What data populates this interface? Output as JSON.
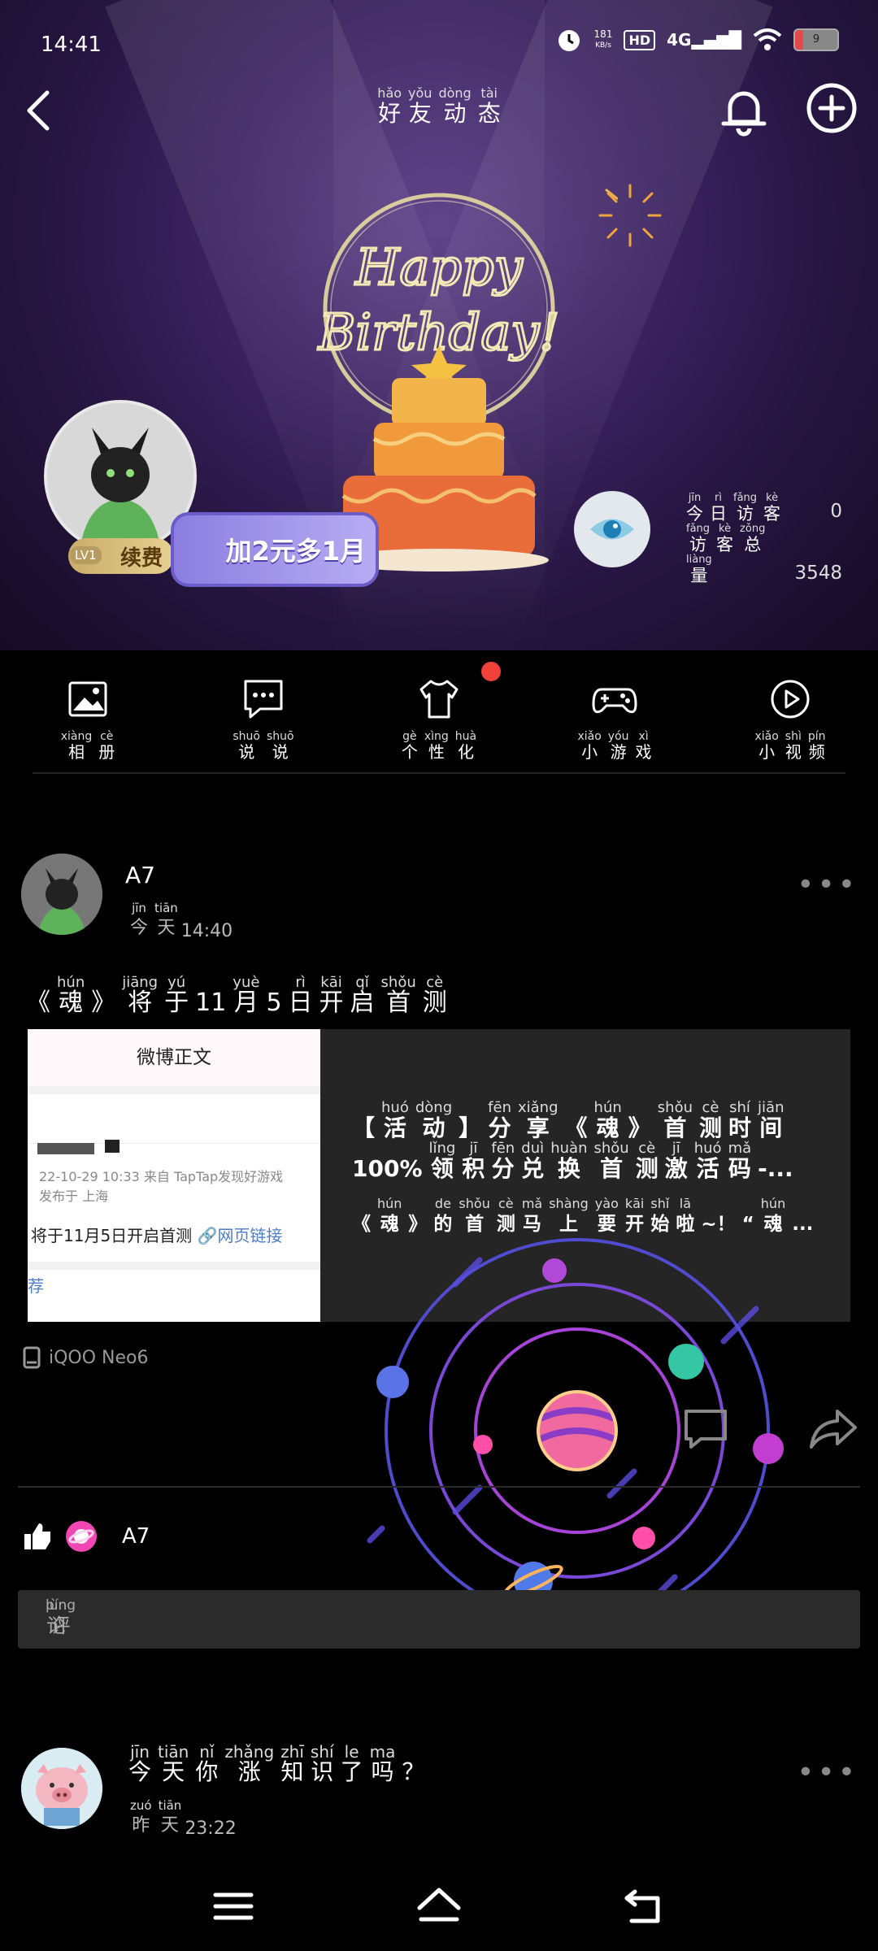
{
  "status_bar": {
    "time": "14:41",
    "net_speed": "181",
    "net_unit": "KB/s",
    "hd": "HD",
    "signal": "4G",
    "battery": "9"
  },
  "header": {
    "title": [
      {
        "py": "hǎo",
        "hz": "好"
      },
      {
        "py": "yǒu",
        "hz": "友"
      },
      {
        "py": "dòng",
        "hz": "动"
      },
      {
        "py": "tài",
        "hz": "态"
      }
    ]
  },
  "banner": {
    "renew_label": "续费",
    "level": "LV1",
    "promo": "加2元多1月",
    "visitors_today_label": [
      {
        "py": "jīn",
        "hz": "今"
      },
      {
        "py": "rì",
        "hz": "日"
      },
      {
        "py": "fǎng",
        "hz": "访"
      },
      {
        "py": "kè",
        "hz": "客"
      }
    ],
    "visitors_today": "0",
    "visitors_total_label": [
      {
        "py": "fǎng",
        "hz": "访"
      },
      {
        "py": "kè",
        "hz": "客"
      },
      {
        "py": "zǒng",
        "hz": "总"
      },
      {
        "py": "liàng",
        "hz": "量"
      }
    ],
    "visitors_total": "3548"
  },
  "menu": [
    {
      "icon": "album-icon",
      "label": [
        {
          "py": "xiàng",
          "hz": "相"
        },
        {
          "py": "cè",
          "hz": "册"
        }
      ]
    },
    {
      "icon": "talk-icon",
      "label": [
        {
          "py": "shuō",
          "hz": "说"
        },
        {
          "py": "shuō",
          "hz": "说"
        }
      ]
    },
    {
      "icon": "shirt-icon",
      "label": [
        {
          "py": "gè",
          "hz": "个"
        },
        {
          "py": "xìng",
          "hz": "性"
        },
        {
          "py": "huà",
          "hz": "化"
        }
      ]
    },
    {
      "icon": "gamepad-icon",
      "label": [
        {
          "py": "xiǎo",
          "hz": "小"
        },
        {
          "py": "yóu",
          "hz": "游"
        },
        {
          "py": "xì",
          "hz": "戏"
        }
      ]
    },
    {
      "icon": "video-icon",
      "label": [
        {
          "py": "xiǎo",
          "hz": "小"
        },
        {
          "py": "shì",
          "hz": "视"
        },
        {
          "py": "pín",
          "hz": "频"
        }
      ]
    }
  ],
  "post1": {
    "username": "A7",
    "time_word": [
      {
        "py": "jīn",
        "hz": "今"
      },
      {
        "py": "tiān",
        "hz": "天"
      }
    ],
    "time_clock": "14:40",
    "text": [
      {
        "py": "",
        "hz": "《"
      },
      {
        "py": "hún",
        "hz": "魂"
      },
      {
        "py": "",
        "hz": "》"
      },
      {
        "py": "jiāng",
        "hz": "将"
      },
      {
        "py": "yú",
        "hz": "于"
      },
      {
        "py": "",
        "hz": "11"
      },
      {
        "py": "yuè",
        "hz": "月"
      },
      {
        "py": "",
        "hz": "5"
      },
      {
        "py": "rì",
        "hz": "日"
      },
      {
        "py": "kāi",
        "hz": "开"
      },
      {
        "py": "qǐ",
        "hz": "启"
      },
      {
        "py": "shǒu",
        "hz": "首"
      },
      {
        "py": "cè",
        "hz": "测"
      }
    ],
    "card_left": {
      "header": "微博正文",
      "meta1": "22-10-29 10:33  来自 TapTap发现好游戏",
      "meta2": "发布于 上海",
      "body": "将于11月5日开启首测",
      "link": "🔗网页链接",
      "footer": "荐"
    },
    "card_title_1": [
      {
        "py": "",
        "hz": "【"
      },
      {
        "py": "huó",
        "hz": "活"
      },
      {
        "py": "dòng",
        "hz": "动"
      },
      {
        "py": "",
        "hz": "】"
      },
      {
        "py": "fēn",
        "hz": "分"
      },
      {
        "py": "xiǎng",
        "hz": "享"
      },
      {
        "py": "",
        "hz": "《"
      },
      {
        "py": "hún",
        "hz": "魂"
      },
      {
        "py": "",
        "hz": "》"
      },
      {
        "py": "shǒu",
        "hz": "首"
      },
      {
        "py": "cè",
        "hz": "测"
      },
      {
        "py": "shí",
        "hz": "时"
      },
      {
        "py": "jiān",
        "hz": "间"
      }
    ],
    "card_title_2": [
      {
        "py": "",
        "hz": "100%"
      },
      {
        "py": "lǐng",
        "hz": "领"
      },
      {
        "py": "jī",
        "hz": "积"
      },
      {
        "py": "fēn",
        "hz": "分"
      },
      {
        "py": "duì",
        "hz": "兑"
      },
      {
        "py": "huàn",
        "hz": "换"
      },
      {
        "py": "shǒu",
        "hz": "首"
      },
      {
        "py": "cè",
        "hz": "测"
      },
      {
        "py": "jī",
        "hz": "激"
      },
      {
        "py": "huó",
        "hz": "活"
      },
      {
        "py": "mǎ",
        "hz": "码"
      },
      {
        "py": "",
        "hz": "-..."
      }
    ],
    "card_sub": [
      {
        "py": "",
        "hz": "《"
      },
      {
        "py": "hún",
        "hz": "魂"
      },
      {
        "py": "",
        "hz": "》"
      },
      {
        "py": "de",
        "hz": "的"
      },
      {
        "py": "shǒu",
        "hz": "首"
      },
      {
        "py": "cè",
        "hz": "测"
      },
      {
        "py": "mǎ",
        "hz": "马"
      },
      {
        "py": "shàng",
        "hz": "上"
      },
      {
        "py": "yào",
        "hz": "要"
      },
      {
        "py": "kāi",
        "hz": "开"
      },
      {
        "py": "shǐ",
        "hz": "始"
      },
      {
        "py": "lā",
        "hz": "啦"
      },
      {
        "py": "",
        "hz": "~！"
      },
      {
        "py": "",
        "hz": "“"
      },
      {
        "py": "hún",
        "hz": "魂"
      },
      {
        "py": "",
        "hz": "..."
      }
    ],
    "device": "iQOO Neo6",
    "liker": "A7",
    "comment_placeholder": [
      {
        "py": "píng",
        "hz": "评"
      },
      {
        "py": "lùn",
        "hz": "论"
      }
    ]
  },
  "post2": {
    "text": [
      {
        "py": "jīn",
        "hz": "今"
      },
      {
        "py": "tiān",
        "hz": "天"
      },
      {
        "py": "nǐ",
        "hz": "你"
      },
      {
        "py": "zhǎng",
        "hz": "涨"
      },
      {
        "py": "zhī",
        "hz": "知"
      },
      {
        "py": "shí",
        "hz": "识"
      },
      {
        "py": "le",
        "hz": "了"
      },
      {
        "py": "ma",
        "hz": "吗"
      },
      {
        "py": "",
        "hz": "？"
      }
    ],
    "time_word": [
      {
        "py": "zuó",
        "hz": "昨"
      },
      {
        "py": "tiān",
        "hz": "天"
      }
    ],
    "time_clock": "23:22"
  },
  "colors": {
    "accent_red": "#f0413a",
    "banner_purple": "#3c2361",
    "card_bg": "#252525"
  }
}
